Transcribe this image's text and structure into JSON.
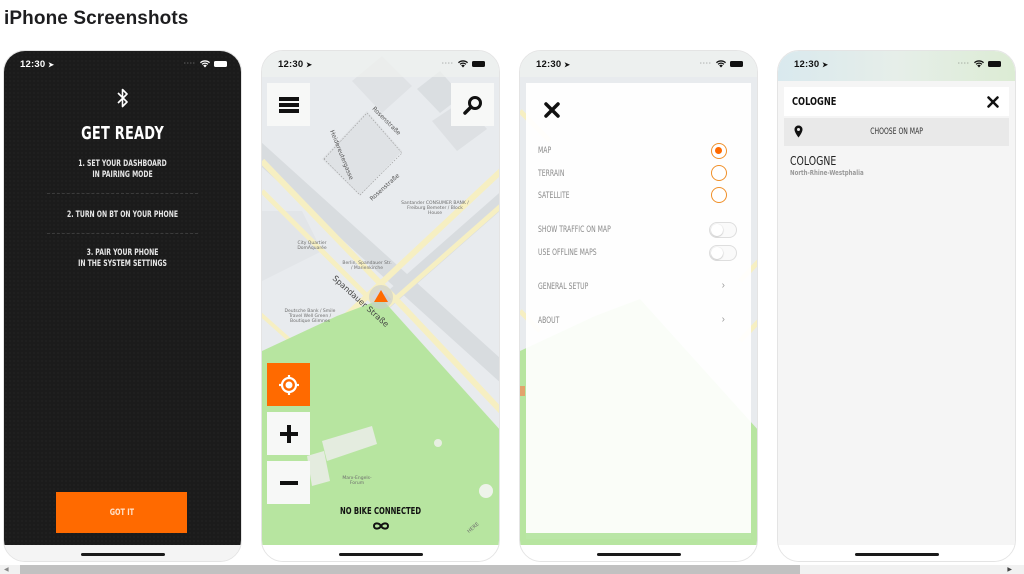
{
  "section": {
    "title": "iPhone Screenshots"
  },
  "status_bar": {
    "time": "12:30"
  },
  "screens": {
    "pairing": {
      "title": "GET READY",
      "steps": [
        [
          "1. SET YOUR DASHBOARD",
          "IN PAIRING MODE"
        ],
        [
          "2. TURN ON BT ON YOUR PHONE"
        ],
        [
          "3. PAIR YOUR PHONE",
          "IN THE SYSTEM SETTINGS"
        ]
      ],
      "button_label": "GOT IT",
      "accent_color": "#ff6a00"
    },
    "map": {
      "status_text": "NO BIKE CONNECTED",
      "street_labels": [
        "Rosenstraße",
        "Heidereutergasse",
        "Rosenstraße",
        "Spandauer Straße"
      ],
      "poi_labels": [
        "Santander CONSUMER BANK / Freiburg Bemeter / Block House",
        "City Quartier DomAquarée",
        "Berlin, Spandauer Str. / Marienkirche",
        "Deutsche Bank / Smile Travel Well Green / Boutique Glimnes",
        "Marx-Engels-Forum"
      ],
      "attribution": "HERE"
    },
    "settings": {
      "map_types": [
        {
          "label": "MAP",
          "selected": true
        },
        {
          "label": "TERRAIN",
          "selected": false
        },
        {
          "label": "SATELLITE",
          "selected": false
        }
      ],
      "toggles": [
        {
          "label": "SHOW TRAFFIC ON MAP",
          "on": false
        },
        {
          "label": "USE OFFLINE MAPS",
          "on": false
        }
      ],
      "links": [
        {
          "label": "GENERAL SETUP"
        },
        {
          "label": "ABOUT"
        }
      ]
    },
    "search": {
      "query": "COLOGNE",
      "choose_on_map_label": "CHOOSE ON MAP",
      "results": [
        {
          "name": "COLOGNE",
          "region": "North-Rhine-Westphalia"
        }
      ]
    }
  }
}
